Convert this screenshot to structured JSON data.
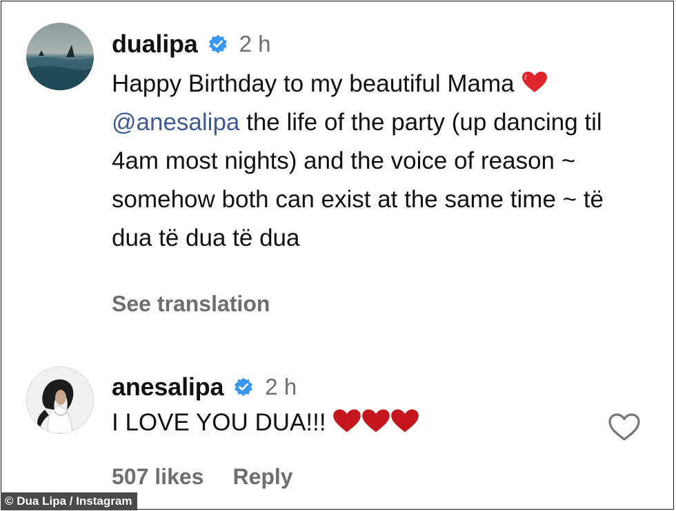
{
  "comment": {
    "username": "dualipa",
    "verified": true,
    "time": "2 h",
    "text_before_mention": "Happy Birthday to my beautiful Mama ",
    "heart_icon": "red-heart-emoji",
    "mention": "@anesalipa",
    "text_after_mention": " the life of the party (up dancing til 4am most nights) and the voice of reason ~ somehow both can exist at the same time ~ të dua të dua të dua",
    "see_translation": "See translation"
  },
  "reply": {
    "username": "anesalipa",
    "verified": true,
    "time": "2 h",
    "text": "I LOVE YOU DUA!!!",
    "heart_emojis": 3,
    "likes": "507 likes",
    "reply_label": "Reply",
    "like_icon": "heart-outline-icon"
  },
  "credit": "© Dua Lipa / Instagram",
  "colors": {
    "mention": "#3d5a93",
    "secondary_text": "#6e6e6e",
    "verified_badge": "#3897f0",
    "heart": "#e0262b"
  }
}
